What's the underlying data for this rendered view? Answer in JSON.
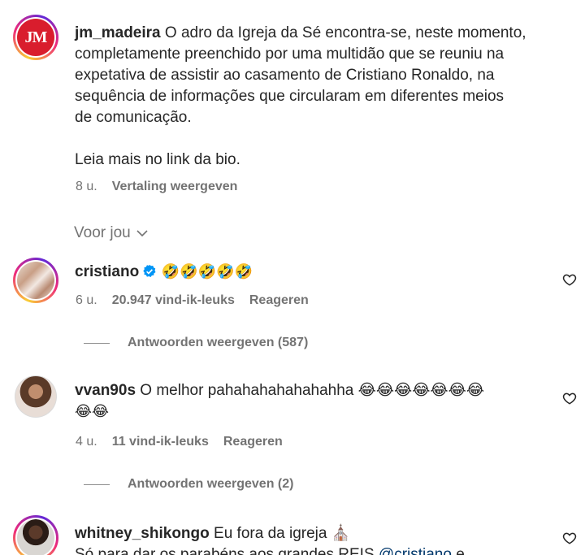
{
  "post": {
    "avatar_text": "JM",
    "username": "jm_madeira",
    "caption_lines": [
      " O adro da Igreja da Sé encontra-se, neste momento,",
      "completamente preenchido por uma multidão que se reuniu na",
      "expetativa de assistir ao casamento de Cristiano Ronaldo, na",
      "sequência de informações que circularam em diferentes meios",
      "de comunicação."
    ],
    "caption_extra": "Leia mais no link da bio.",
    "time": "8 u.",
    "translate_label": "Vertaling weergeven"
  },
  "filter": {
    "label": "Voor jou"
  },
  "comments": [
    {
      "username": "cristiano",
      "verified": true,
      "text": " 🤣🤣🤣🤣🤣",
      "time": "6 u.",
      "likes": "20.947 vind-ik-leuks",
      "reply_label": "Reageren",
      "view_replies": "Antwoorden weergeven (587)"
    },
    {
      "username": "vvan90s",
      "text_line1": " O melhor pahahahahahahahha 😂😂😂😂😂😂😂",
      "text_line2": "😂😂",
      "time": "4 u.",
      "likes": "11 vind-ik-leuks",
      "reply_label": "Reageren",
      "view_replies": "Antwoorden weergeven (2)"
    },
    {
      "username": "whitney_shikongo",
      "text_line1": " Eu fora da igreja ⛪",
      "text_line2_start": "Só para dar os parabéns aos grandes REIS ",
      "mention": "@cristiano",
      "text_line2_end": " e"
    }
  ],
  "colors": {
    "verified": "#0095f6",
    "meta": "#737373",
    "mention": "#00376b",
    "jm_brand": "#d91d2d"
  },
  "icons": {
    "heart": "heart-outline-icon",
    "chevron": "chevron-down-icon",
    "verified": "verified-badge-icon"
  }
}
